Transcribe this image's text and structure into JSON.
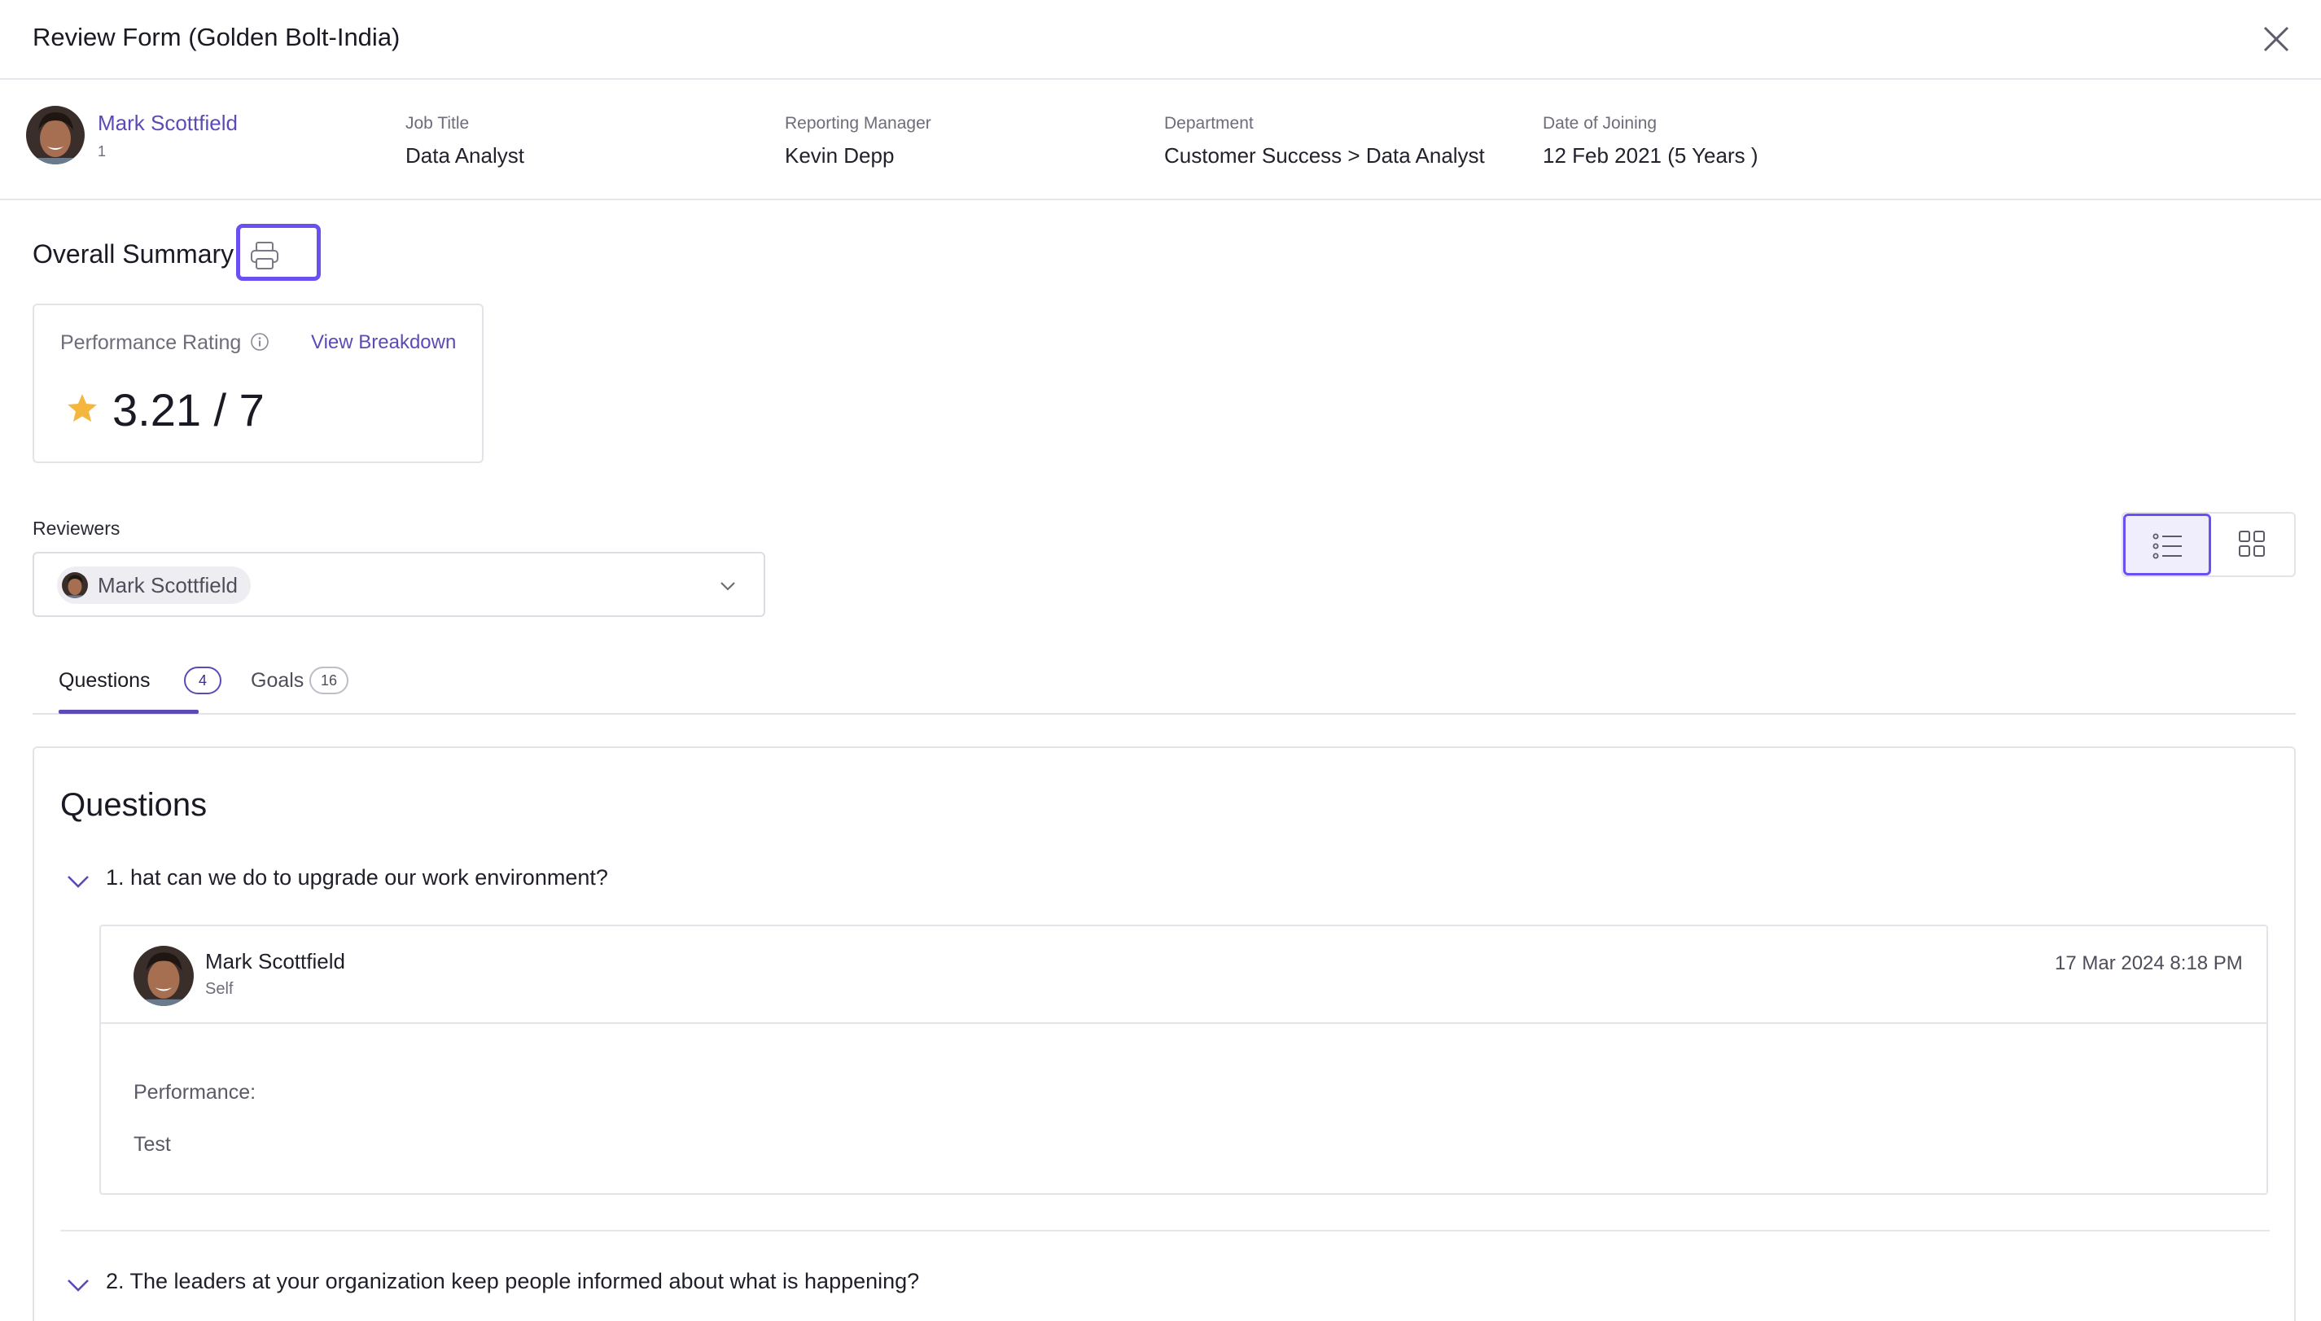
{
  "header": {
    "title": "Review Form (Golden Bolt-India)"
  },
  "employee": {
    "name": "Mark Scottfield",
    "id": "1",
    "fields": [
      {
        "label": "Job Title",
        "value": "Data Analyst"
      },
      {
        "label": "Reporting Manager",
        "value": "Kevin Depp"
      },
      {
        "label": "Department",
        "value": "Customer Success > Data Analyst"
      },
      {
        "label": "Date of Joining",
        "value": "12 Feb 2021 (5 Years )"
      }
    ]
  },
  "summary": {
    "title": "Overall Summary",
    "rating_label": "Performance Rating",
    "view_breakdown": "View Breakdown",
    "rating_value": "3.21 / 7",
    "rating_score": 3.21,
    "rating_max": 7
  },
  "reviewers": {
    "label": "Reviewers",
    "selected": "Mark Scottfield"
  },
  "view_toggle": {
    "active": "list"
  },
  "tabs": [
    {
      "label": "Questions",
      "count": "4",
      "active": true
    },
    {
      "label": "Goals",
      "count": "16",
      "active": false
    }
  ],
  "questions": {
    "title": "Questions",
    "items": [
      {
        "text": "1. hat can we do to upgrade our work environment?",
        "answer": {
          "name": "Mark Scottfield",
          "role": "Self",
          "date": "17 Mar 2024 8:18 PM",
          "label": "Performance:",
          "value": "Test"
        }
      },
      {
        "text": "2.  The leaders at your organization keep people informed about what is happening?"
      }
    ]
  },
  "colors": {
    "accent": "#5b4bb7",
    "highlight": "#6c4ff0",
    "star": "#f4b63f"
  },
  "icons": [
    "close-icon",
    "printer-icon",
    "info-icon",
    "star-icon",
    "chevron-down-icon",
    "list-view-icon",
    "grid-view-icon"
  ]
}
